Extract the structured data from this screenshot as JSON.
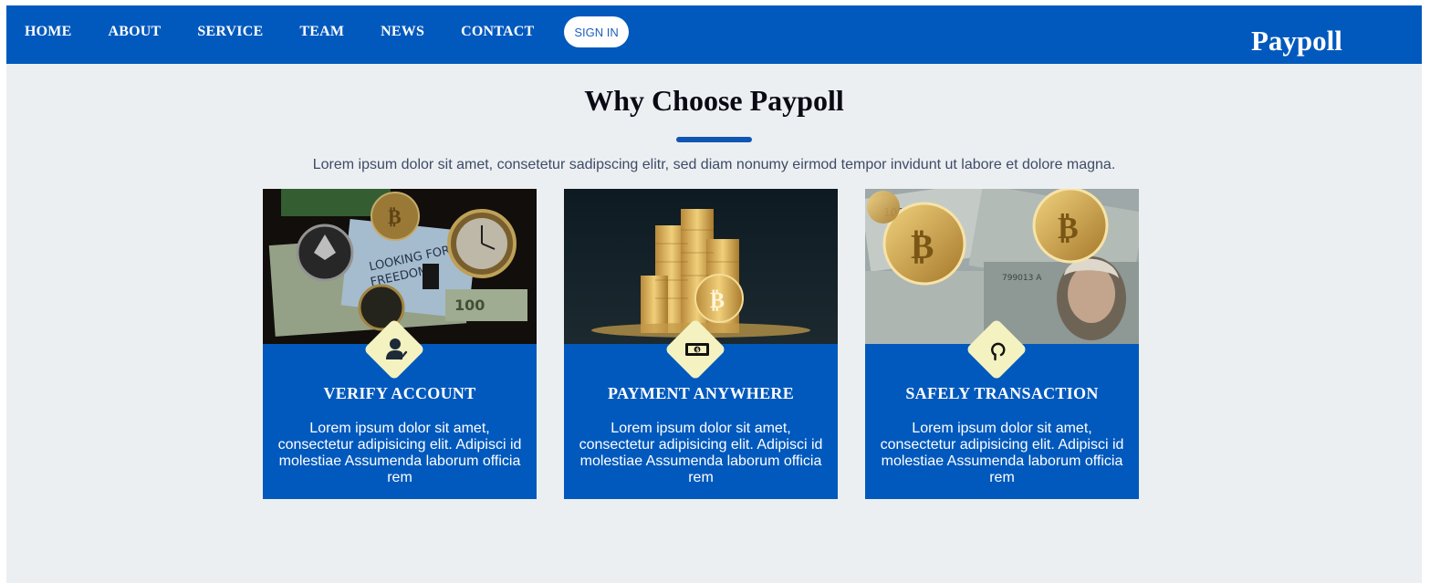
{
  "nav": {
    "links": [
      "HOME",
      "ABOUT",
      "SERVICE",
      "TEAM",
      "NEWS",
      "CONTACT"
    ],
    "signin_label": "SIGN IN",
    "brand": "Paypoll"
  },
  "section": {
    "title": "Why Choose Paypoll",
    "subtitle": "Lorem ipsum dolor sit amet, consetetur sadipscing elitr, sed diam nonumy eirmod tempor invidunt ut labore et dolore magna."
  },
  "cards": [
    {
      "title": "VERIFY ACCOUNT",
      "text": "Lorem ipsum dolor sit amet, consectetur adipisicing elit. Adipisci id molestiae Assumenda laborum officia rem",
      "icon": "user-check-icon",
      "image": "crypto-coins-dollar-bills-photo"
    },
    {
      "title": "PAYMENT ANYWHERE",
      "text": "Lorem ipsum dolor sit amet, consectetur adipisicing elit. Adipisci id molestiae Assumenda laborum officia rem",
      "icon": "money-bill-icon",
      "image": "bitcoin-coin-stacks-photo"
    },
    {
      "title": "SAFELY TRANSACTION",
      "text": "Lorem ipsum dolor sit amet, consectetur adipisicing elit. Adipisci id molestiae Assumenda laborum officia rem",
      "icon": "refresh-arrow-icon",
      "image": "bitcoins-on-hundred-dollar-bills-photo"
    }
  ],
  "colors": {
    "primary": "#0159bd",
    "background": "#eceff2",
    "icon_badge": "#f4f2c0",
    "title_text": "#0a0a14"
  }
}
